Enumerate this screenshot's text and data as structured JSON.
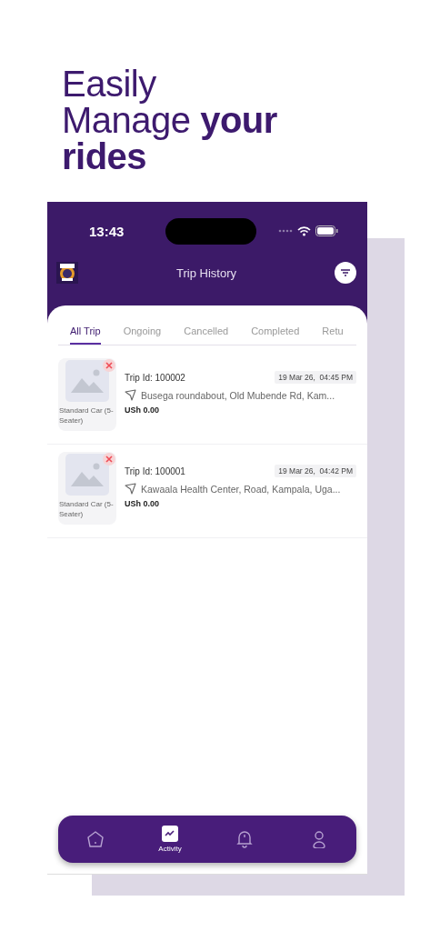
{
  "headline": {
    "lines": [
      "Easily",
      "Manage **your**",
      "**rides**"
    ]
  },
  "status_bar": {
    "time": "13:43"
  },
  "header": {
    "title": "Trip History"
  },
  "tabs": [
    {
      "label": "All Trip",
      "selected": true
    },
    {
      "label": "Ongoing",
      "selected": false
    },
    {
      "label": "Cancelled",
      "selected": false
    },
    {
      "label": "Completed",
      "selected": false
    },
    {
      "label": "Retu",
      "selected": false
    }
  ],
  "trips": [
    {
      "vehicle": "Standard Car (5-Seater)",
      "trip_id": "Trip Id: 100002",
      "date": "19 Mar 26,  04:45 PM",
      "address": "Busega roundabout, Old Mubende Rd, Kam...",
      "fare": "USh 0.00"
    },
    {
      "vehicle": "Standard Car (5-Seater)",
      "trip_id": "Trip Id: 100001",
      "date": "19 Mar 26,  04:42 PM",
      "address": "Kawaala Health Center, Road, Kampala, Uga...",
      "fare": "USh 0.00"
    }
  ],
  "bottom_nav": [
    {
      "kind": "home",
      "selected": false
    },
    {
      "kind": "activity",
      "selected": true,
      "label": "Activity"
    },
    {
      "kind": "bell",
      "selected": false
    },
    {
      "kind": "profile",
      "selected": false
    }
  ]
}
